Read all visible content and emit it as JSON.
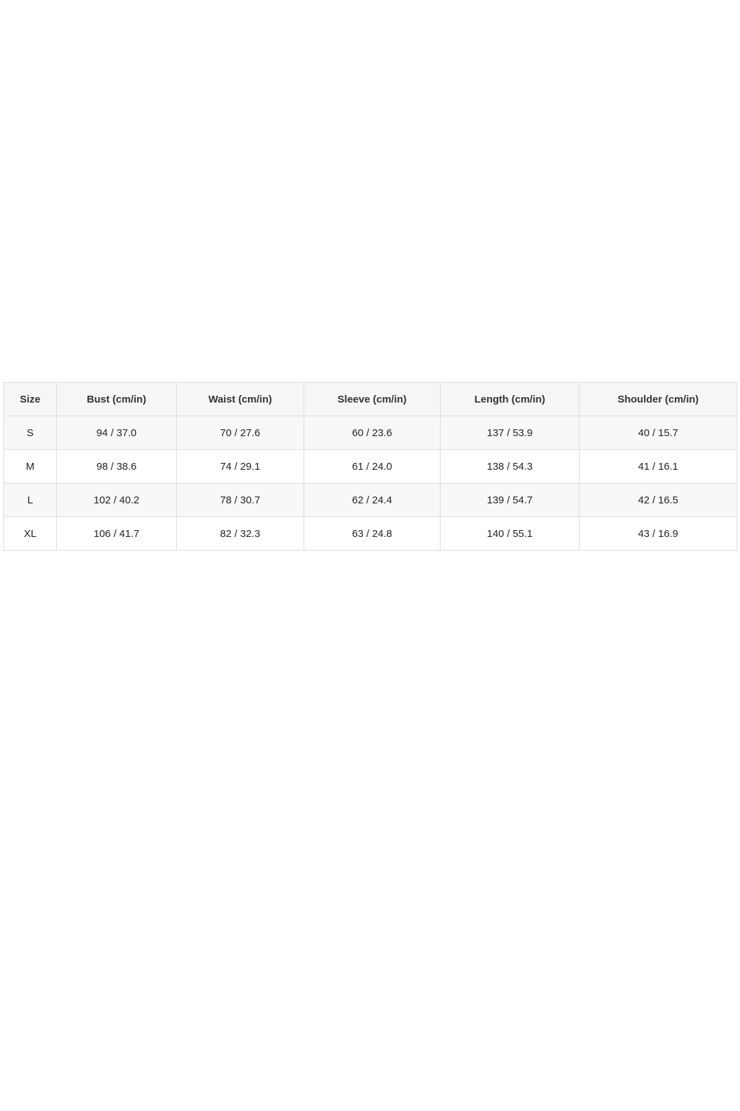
{
  "size_chart": {
    "headers": [
      "Size",
      "Bust (cm/in)",
      "Waist (cm/in)",
      "Sleeve (cm/in)",
      "Length (cm/in)",
      "Shoulder (cm/in)"
    ],
    "rows": [
      [
        "S",
        "94 / 37.0",
        "70 / 27.6",
        "60 / 23.6",
        "137 / 53.9",
        "40 / 15.7"
      ],
      [
        "M",
        "98 / 38.6",
        "74 / 29.1",
        "61 / 24.0",
        "138 / 54.3",
        "41 / 16.1"
      ],
      [
        "L",
        "102 / 40.2",
        "78 / 30.7",
        "62 / 24.4",
        "139 / 54.7",
        "42 / 16.5"
      ],
      [
        "XL",
        "106 / 41.7",
        "82 / 32.3",
        "63 / 24.8",
        "140 / 55.1",
        "43 / 16.9"
      ]
    ]
  }
}
